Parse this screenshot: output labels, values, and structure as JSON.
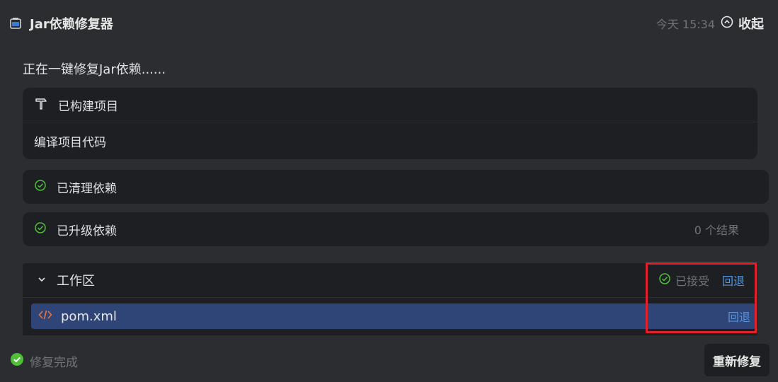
{
  "header": {
    "title": "Jar依赖修复器",
    "time": "今天 15:34",
    "collapse_label": "收起",
    "icon": "jar-icon"
  },
  "status_line": "正在一键修复Jar依赖......",
  "build_step": {
    "label": "已构建项目",
    "detail": "编译项目代码",
    "icon": "hammer-icon"
  },
  "clean_step": {
    "label": "已清理依赖",
    "icon": "check-circle-icon"
  },
  "upgrade_step": {
    "label": "已升级依赖",
    "result_count": "0 个结果",
    "icon": "check-circle-icon"
  },
  "workspace": {
    "title": "工作区",
    "accepted_label": "已接受",
    "revert_label": "回退",
    "files": [
      {
        "name": "pom.xml",
        "revert_label": "回退",
        "icon": "code-icon"
      }
    ]
  },
  "footer": {
    "done_label": "修复完成",
    "retry_label": "重新修复"
  },
  "colors": {
    "background": "#2b2d30",
    "card": "#1e1f22",
    "accent": "#5294e2",
    "selected_row": "#2f4577",
    "success": "#4fbf3a",
    "highlight": "#e0202a"
  }
}
